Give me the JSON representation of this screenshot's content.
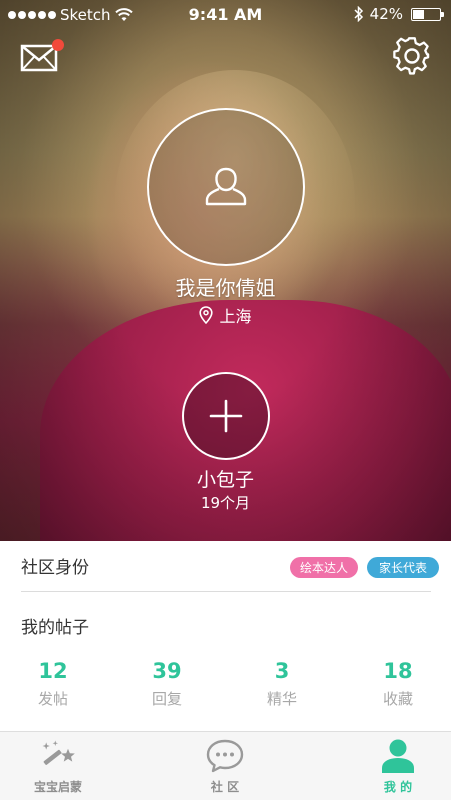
{
  "status_bar": {
    "carrier": "Sketch",
    "time": "9:41 AM",
    "battery_percent": "42%",
    "battery_level": 0.42
  },
  "header": {
    "mail_icon": "mail-icon",
    "mail_has_unread": true,
    "settings_icon": "gear-icon"
  },
  "profile": {
    "avatar_icon": "user-outline-icon",
    "name": "我是你倩姐",
    "location": "上海"
  },
  "baby": {
    "add_icon": "plus-icon",
    "name": "小包子",
    "age": "19个月"
  },
  "community": {
    "title": "社区身份",
    "tags": [
      {
        "label": "绘本达人",
        "color": "#f070a8"
      },
      {
        "label": "家长代表",
        "color": "#3fa9d8"
      }
    ]
  },
  "posts": {
    "title": "我的帖子",
    "stats": [
      {
        "value": "12",
        "label": "发帖"
      },
      {
        "value": "39",
        "label": "回复"
      },
      {
        "value": "3",
        "label": "精华"
      },
      {
        "value": "18",
        "label": "收藏"
      }
    ]
  },
  "tabbar": {
    "active_color": "#2fc49a",
    "inactive_color": "#8e8e8e",
    "tabs": [
      {
        "label": "宝宝启蒙",
        "icon": "magic-wand-icon",
        "active": false
      },
      {
        "label": "社 区",
        "icon": "chat-bubble-icon",
        "active": false
      },
      {
        "label": "我 的",
        "icon": "person-icon",
        "active": true
      }
    ]
  }
}
